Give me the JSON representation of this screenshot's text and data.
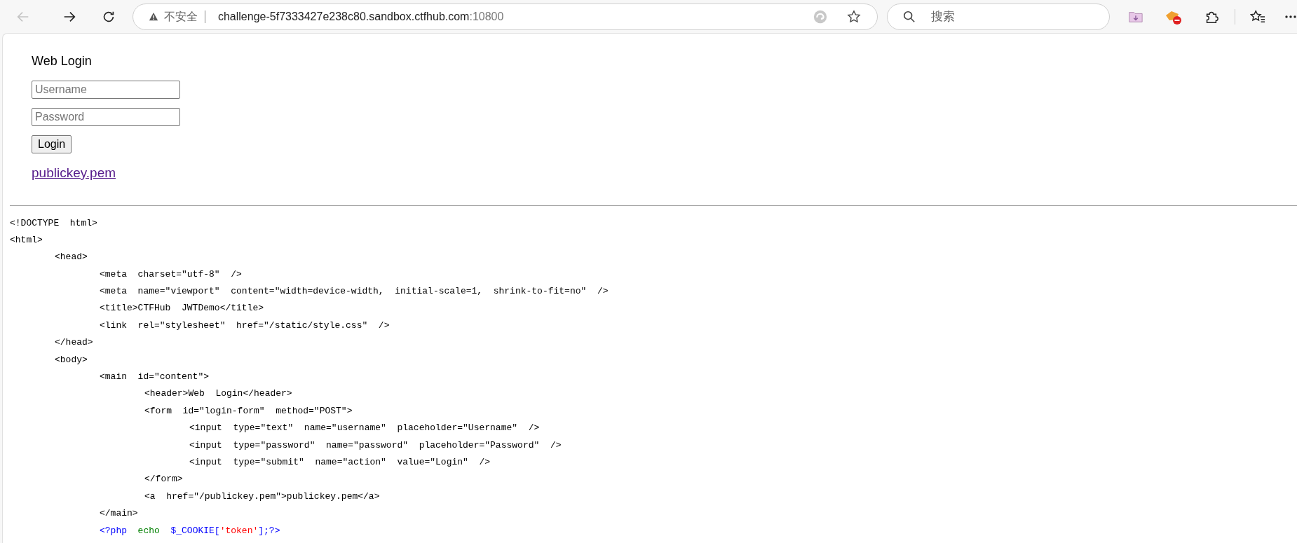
{
  "browser": {
    "security_label": "不安全",
    "url_host": "challenge-5f7333427e238c80.sandbox.ctfhub.com",
    "url_port": ":10800",
    "search_placeholder": "搜索"
  },
  "login": {
    "header": "Web Login",
    "fields": [
      {
        "placeholder": "Username"
      },
      {
        "placeholder": "Password"
      }
    ],
    "button": "Login",
    "link": "publickey.pem"
  },
  "source": [
    {
      "text": "<!DOCTYPE  html>"
    },
    {
      "text": "<html>",
      "children": [
        {
          "text": "<head>",
          "children": [
            {
              "text": "<meta  charset=\"utf-8\"  />"
            },
            {
              "text": "<meta  name=\"viewport\"  content=\"width=device-width,  initial-scale=1,  shrink-to-fit=no\"  />"
            },
            {
              "text": "<title>CTFHub  JWTDemo</title>"
            },
            {
              "text": "<link  rel=\"stylesheet\"  href=\"/static/style.css\"  />"
            }
          ]
        },
        {
          "text": "</head>"
        },
        {
          "text": "<body>",
          "children": [
            {
              "text": "<main  id=\"content\">",
              "children": [
                {
                  "text": "<header>Web  Login</header>"
                },
                {
                  "text": "<form  id=\"login-form\"  method=\"POST\">",
                  "children": [
                    {
                      "text": "<input  type=\"text\"  name=\"username\"  placeholder=\"Username\"  />"
                    },
                    {
                      "text": "<input  type=\"password\"  name=\"password\"  placeholder=\"Password\"  />"
                    },
                    {
                      "text": "<input  type=\"submit\"  name=\"action\"  value=\"Login\"  />"
                    }
                  ]
                },
                {
                  "text": "</form>"
                },
                {
                  "text": "<a  href=\"/publickey.pem\">publickey.pem</a>"
                }
              ]
            },
            {
              "text": "</main>"
            },
            {
              "segments": [
                {
                  "text": "<?php",
                  "color": "#0000ff"
                },
                {
                  "text": "  echo",
                  "color": "#008000"
                },
                {
                  "text": "  $_COOKIE[",
                  "color": "#0000ff"
                },
                {
                  "text": "'token'",
                  "color": "#ff0000"
                },
                {
                  "text": "];?>",
                  "color": "#0000ff"
                }
              ]
            }
          ]
        }
      ]
    }
  ]
}
